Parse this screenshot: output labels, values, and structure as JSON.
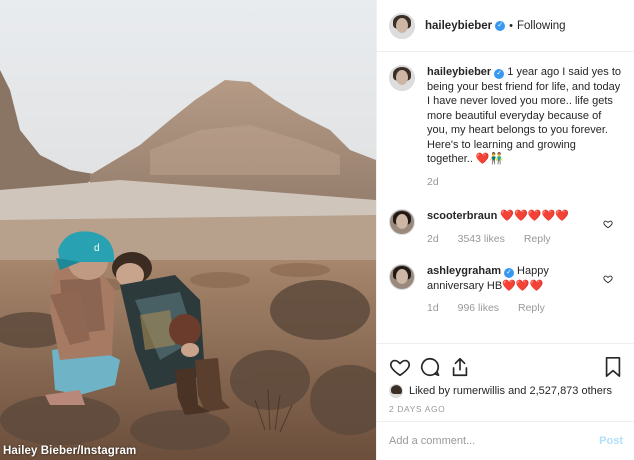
{
  "photo": {
    "credit": "Hailey Bieber/Instagram",
    "cap_logo_text": "d"
  },
  "header": {
    "username": "haileybieber",
    "separator": "•",
    "follow_status": "Following"
  },
  "caption": {
    "username": "haileybieber",
    "text": "1 year ago I said yes to being your best friend for life, and today I have never loved you more.. life gets more beautiful everyday because of you, my heart belongs to you forever. Here's to learning and growing together.. ❤️👬",
    "age": "2d"
  },
  "comments": [
    {
      "username": "scooterbraun",
      "text": "❤️❤️❤️❤️❤️",
      "age": "2d",
      "likes": "3543 likes",
      "reply_label": "Reply"
    },
    {
      "username": "ashleygraham",
      "text": "Happy anniversary HB❤️❤️❤️",
      "age": "1d",
      "likes": "996 likes",
      "reply_label": "Reply"
    }
  ],
  "likes": {
    "prefix": "Liked by",
    "user": "rumerwillis",
    "conjunction": "and",
    "others": "2,527,873 others"
  },
  "post_date": "2 DAYS AGO",
  "add_comment": {
    "placeholder": "Add a comment...",
    "post_label": "Post"
  },
  "colors": {
    "verified": "#3897f0",
    "post_button": "#b2dffc",
    "muted": "#999999"
  }
}
